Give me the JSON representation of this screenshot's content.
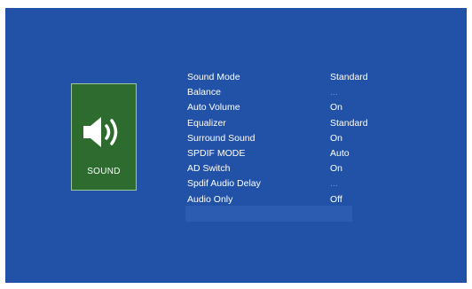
{
  "category": {
    "label": "SOUND",
    "icon": "speaker-volume-icon",
    "colors": {
      "tile": "#2e6b2e",
      "screen": "#2252a8"
    }
  },
  "menu": {
    "items": [
      {
        "label": "Sound Mode",
        "value": "Standard"
      },
      {
        "label": "Balance",
        "value": "..."
      },
      {
        "label": "Auto Volume",
        "value": "On"
      },
      {
        "label": "Equalizer",
        "value": "Standard"
      },
      {
        "label": "Surround Sound",
        "value": "On"
      },
      {
        "label": "SPDIF MODE",
        "value": "Auto"
      },
      {
        "label": "AD Switch",
        "value": "On"
      },
      {
        "label": "Spdif Audio Delay",
        "value": "..."
      },
      {
        "label": "Audio Only",
        "value": "Off"
      }
    ]
  }
}
